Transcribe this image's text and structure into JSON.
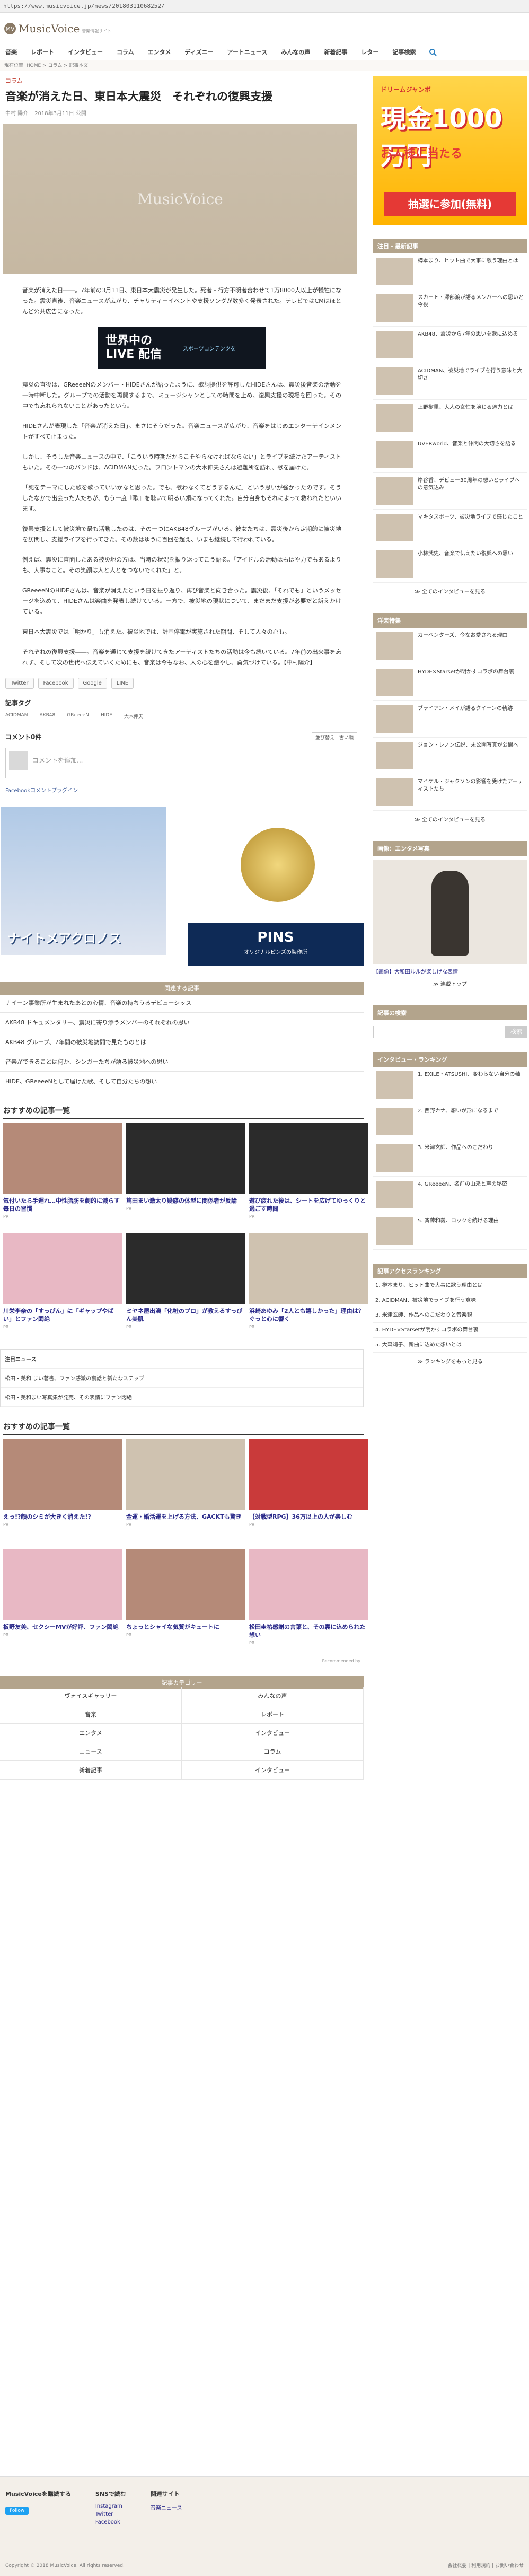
{
  "browser": {
    "url": "https://www.musicvoice.jp/news/20180311068252/"
  },
  "header": {
    "logo_mark": "MV",
    "logo_text": "MusicVoice",
    "logo_sub": "音楽情報サイト"
  },
  "nav": {
    "items": [
      "音楽",
      "レポート",
      "インタビュー",
      "コラム",
      "エンタメ",
      "ディズニー",
      "アートニュース",
      "みんなの声",
      "新着記事",
      "レター",
      "記事検索"
    ]
  },
  "breadcrumb": "現在位置: HOME > コラム > 記事本文",
  "article": {
    "category": "コラム",
    "title": "音楽が消えた日、東日本大震災　それぞれの復興支援",
    "author": "中村 陽介",
    "date": "2018年3月11日 公開",
    "hero_watermark": "MusicVoice",
    "paragraphs": [
      "音楽が消えた日――。7年前の3月11日、東日本大震災が発生した。死者・行方不明者合わせて1万8000人以上が犠牲になった。震災直後、音楽ニュースが広がり、チャリティーイベントや支援ソングが数多く発表された。テレビではCMはほとんど公共広告になった。",
      "震災の直後は、GReeeeNのメンバー・HIDEさんが語ったように、歌詞提供を許可したHIDEさんは、震災後音楽の活動を一時中断した。グループでの活動を再開するまで、ミュージシャンとしての時間を止め、復興支援の現場を回った。その中でも忘れられないことがあったという。",
      "HIDEさんが表現した「音楽が消えた日」。まさにそうだった。音楽ニュースが広がり、音楽をはじめエンターテインメントがすべて止まった。",
      "しかし、そうした音楽ニュースの中で、「こういう時期だからこそやらなければならない」とライブを続けたアーティストもいた。その一つのバンドは、ACIDMANだった。フロントマンの大木伸夫さんは避難所を訪れ、歌を届けた。",
      "「死をテーマにした歌を歌っていいかなと思った。でも、歌わなくてどうするんだ」という思いが強かったのです。そうしたなかで出会った人たちが、もう一度『歌』を聴いて明るい顔になってくれた。自分自身もそれによって救われたといいます。",
      "復興支援として被災地で最も活動したのは、そのーつにAKB48グループがいる。彼女たちは、震災後から定期的に被災地を訪問し、支援ライブを行ってきた。その数はゆうに百回を超え、いまも継続して行われている。",
      "例えば、震災に直面したある被災地の方は、当時の状況を振り返ってこう語る。「アイドルの活動はもはや力でもあるよりも、大事なこと。その笑顔は人と人とをつないでくれた」と。",
      "GReeeeNのHIDEさんは、音楽が消えたという日を振り返り、再び音楽と向き合った。震災後、「それでも」というメッセージを込めて、HIDEさんは楽曲を発表し続けている。一方で、被災地の現状について、まだまだ支援が必要だと訴えかけている。",
      "東日本大震災では「明かり」も消えた。被災地では、計画停電が実施された期間、そして人々の心も。",
      "それぞれの復興支援――。音楽を通じて支援を続けてきたアーティストたちの活動は今も続いている。7年前の出来事を忘れず、そして次の世代へ伝えていくためにも、音楽は今もなお、人の心を癒やし、勇気づけている。【中村陽介】"
    ],
    "ad_big": "世界中の LIVE 配信",
    "ad_small": "スポーツコンテンツを"
  },
  "share": {
    "twitter": "Twitter",
    "facebook": "Facebook",
    "google": "Google",
    "line": "LINE"
  },
  "tags": {
    "heading": "記事タグ",
    "items": [
      "ACIDMAN",
      "AKB48",
      "GReeeeN",
      "HIDE",
      "大木伸夫"
    ]
  },
  "comments": {
    "heading": "コメント0件",
    "sort": "並び替え　古い順",
    "placeholder": "コメントを追加...",
    "plugin": "Facebookコメントプラグイン"
  },
  "promo": {
    "left_caption": "ナイトメアクロノス",
    "right_big": "PINS",
    "right_small": "オリジナルピンズの製作所"
  },
  "related": {
    "heading": "関連する記事",
    "items": [
      "ナイーン事業所が生まれたあとの心情、音楽の持ちうるデビューシッス",
      "AKB48 ドキュメンタリー、震災に寄り添うメンバーのそれぞれの思い",
      "AKB48 グループ、7年間の被災地訪問で見たものとは",
      "音楽ができることは何か、シンガーたちが語る被災地への思い",
      "HIDE、GReeeeNとして届けた歌、そして自分たちの想い"
    ]
  },
  "recommend": {
    "heading": "おすすめの記事一覧",
    "cards": [
      {
        "title": "気付いたら手遅れ…中性脂肪を劇的に減らす毎日の習慣",
        "src": "PR"
      },
      {
        "title": "篤田まい激太り疑惑の体型に関係者が反論",
        "src": "PR"
      },
      {
        "title": "遊び疲れた後は、シートを広げてゆっくりと過ごす時間",
        "src": "PR"
      },
      {
        "title": "川栄李奈の「すっぴん」に「ギャップやばい」とファン悶絶",
        "src": "PR"
      },
      {
        "title": "ミヤネ屋出演「化粧のプロ」が教えるすっぴん美肌",
        "src": "PR"
      },
      {
        "title": "浜崎あゆみ「2人とも嬉しかった」理由は？ぐっと心に響く",
        "src": "PR"
      }
    ]
  },
  "news": {
    "heading": "注目ニュース",
    "items": [
      "松田・美和 まい著書、ファン感激の裏話と新たなステップ",
      "松田・美和まい写真集が発売、その表情にファン悶絶"
    ]
  },
  "recommend2": {
    "heading": "おすすめの記事一覧",
    "cards": [
      {
        "title": "えっ!?顔のシミが大きく消えた!?",
        "src": "PR"
      },
      {
        "title": "金運・婚活運を上げる方法、GACKTも驚き",
        "src": "PR"
      },
      {
        "title": "【対戦型RPG】36万以上の人が楽しむ",
        "src": "PR"
      },
      {
        "title": "板野友美、セクシーMVが好評、ファン悶絶",
        "src": "PR"
      },
      {
        "title": "ちょっとシャイな気質がキュートに",
        "src": "PR"
      },
      {
        "title": "松田圭祐感謝の言葉と、その裏に込められた想い",
        "src": "PR"
      }
    ],
    "footer_note": "Recommended by"
  },
  "categories": {
    "heading": "記事カテゴリー",
    "items": [
      "ヴォイスギャラリー",
      "みんなの声",
      "音楽",
      "レポート",
      "エンタメ",
      "インタビュー",
      "ニュース",
      "コラム",
      "新着記事",
      "インタビュー"
    ]
  },
  "side": {
    "ad_top": "ドリームジャンボ",
    "ad_big": "現金1000万円",
    "ad_mid": "お人様に当たる",
    "ad_button": "抽選に参加(無料)",
    "news_heading": "注目・最新記事",
    "news_items": [
      "樽本まり、ヒット曲で大事に歌う理由とは",
      "スカート・澤部渡が語るメンバーへの思いと今後",
      "AKB48、震災から7年の思いを歌に込める",
      "ACIDMAN、被災地でライブを行う意味と大切さ",
      "上野樹里、大人の女性を演じる魅力とは",
      "UVERworld、音楽と仲間の大切さを語る",
      "岸谷香、デビュー30周年の想いとライブへの意気込み",
      "マキタスポーツ、被災地ライブで感じたこと",
      "小林武史、音楽で伝えたい復興への思い"
    ],
    "news_more": "≫ 全てのインタビューを見る",
    "voice_heading": "洋楽特集",
    "voice_items": [
      "カーペンターズ、今なお愛される理由",
      "HYDE×Starsetが明かすコラボの舞台裏",
      "ブライアン・メイが語るクイーンの軌跡",
      "ジョン・レノン伝説、未公開写真が公開へ",
      "マイケル・ジャクソンの影響を受けたアーティストたち"
    ],
    "voice_more": "≫ 全てのインタビューを見る",
    "photo_heading": "画像：エンタメ写真",
    "photo_caption": "【画像】大和田ルルが楽しげな表情",
    "photo_more": "≫ 連載トップ",
    "search_heading": "記事の検索",
    "search_btn": "検索",
    "interview_heading": "インタビュー・ランキング",
    "interview_items": [
      "1. EXILE・ATSUSHI、変わらない自分の軸",
      "2. 西野カナ、想いが形になるまで",
      "3. 米津玄師、作品へのこだわり",
      "4. GReeeeN、名前の由来と声の秘密",
      "5. 斉藤和義、ロックを続ける理由"
    ],
    "access_heading": "記事アクセスランキング",
    "access_items": [
      "1. 樽本まり、ヒット曲で大事に歌う理由とは",
      "2. ACIDMAN、被災地でライブを行う意味",
      "3. 米津玄師、作品へのこだわりと音楽観",
      "4. HYDE×Starsetが明かすコラボの舞台裏",
      "5. 大森靖子、新曲に込めた想いとは"
    ],
    "access_more": "≫ ランキングをもっと見る"
  },
  "footer": {
    "col1_h": "MusicVoiceを購読する",
    "col1_follow": "Follow",
    "col2_h": "SNSで読む",
    "col2_links": [
      "Instagram",
      "Twitter",
      "Facebook"
    ],
    "col3_h": "関連サイト",
    "col3_links": [
      "音楽ニュース"
    ],
    "copyright": "Copyright © 2018 MusicVoice. All rights reserved.",
    "right_links": "会社概要 | 利用規約 | お問い合わせ"
  }
}
